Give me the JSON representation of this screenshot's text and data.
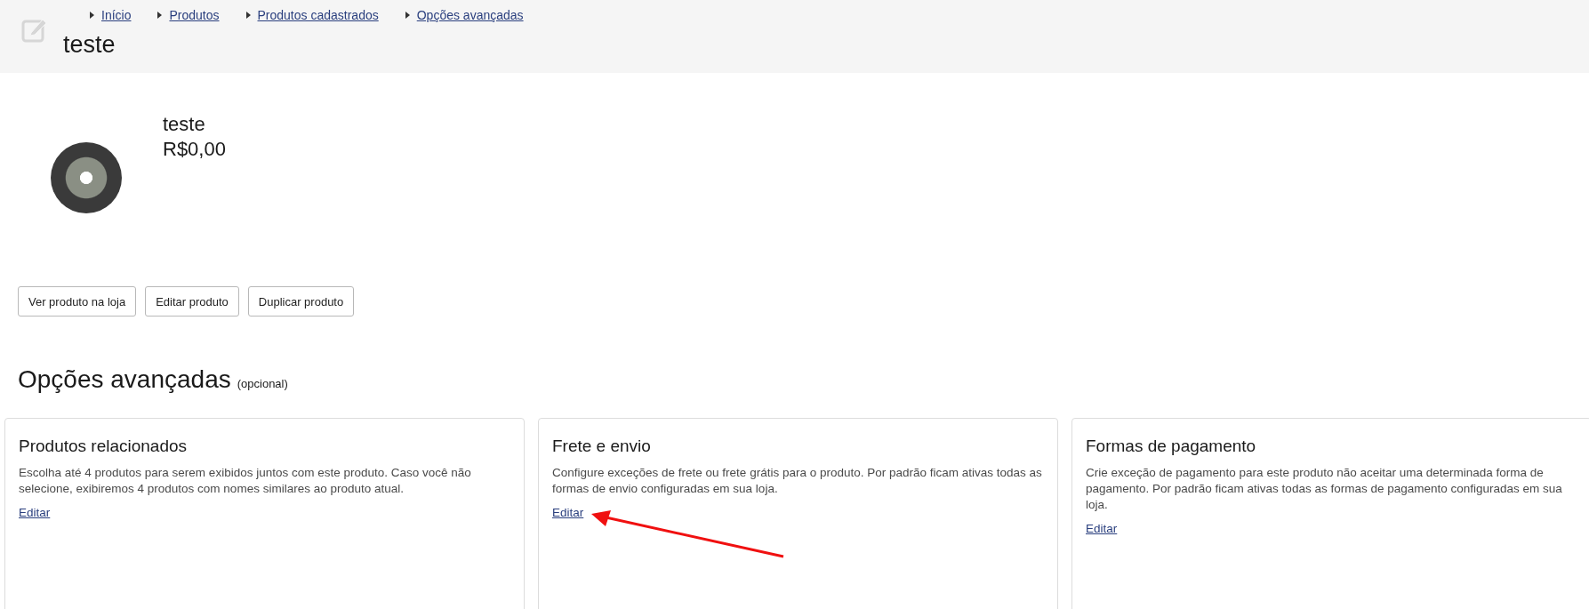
{
  "header": {
    "breadcrumbs": [
      "Início",
      "Produtos",
      "Produtos cadastrados",
      "Opções avançadas"
    ],
    "title": "teste"
  },
  "product": {
    "name": "teste",
    "price": "R$0,00"
  },
  "actions": [
    "Ver produto na loja",
    "Editar produto",
    "Duplicar produto"
  ],
  "section": {
    "title": "Opções avançadas",
    "note": "(opcional)"
  },
  "cards": [
    {
      "title": "Produtos relacionados",
      "description": "Escolha até 4 produtos para serem exibidos juntos com este produto. Caso você não selecione, exibiremos 4 produtos com nomes similares ao produto atual.",
      "link": "Editar"
    },
    {
      "title": "Frete e envio",
      "description": "Configure exceções de frete ou frete grátis para o produto. Por padrão ficam ativas todas as formas de envio configuradas em sua loja.",
      "link": "Editar"
    },
    {
      "title": "Formas de pagamento",
      "description": "Crie exceção de pagamento para este produto não aceitar uma determinada forma de pagamento. Por padrão ficam ativas todas as formas de pagamento configuradas em sua loja.",
      "link": "Editar"
    }
  ]
}
